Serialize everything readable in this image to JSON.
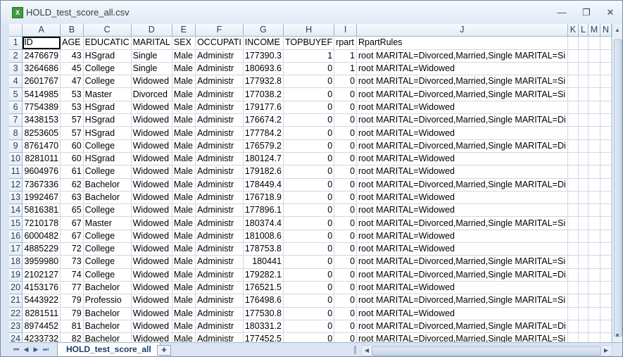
{
  "window": {
    "title": "HOLD_test_score_all.csv",
    "app_icon_letter": "X",
    "minimize_glyph": "—",
    "restore_glyph": "❐",
    "close_glyph": "✕"
  },
  "grid": {
    "column_letters": [
      "A",
      "B",
      "C",
      "D",
      "E",
      "F",
      "G",
      "H",
      "I",
      "J",
      "K",
      "L",
      "M",
      "N"
    ],
    "active_column": "A",
    "active_row": 1,
    "header_row": [
      "ID",
      "AGE",
      "EDUCATIC",
      "MARITAL",
      "SEX",
      "OCCUPATI",
      "INCOME",
      "TOPBUYEF",
      "rpart",
      "RpartRules",
      "",
      "",
      "",
      ""
    ],
    "rows": [
      [
        "2476679",
        "43",
        "HSgrad",
        "Single",
        "Male",
        "Administr",
        "177390.3",
        "1",
        "1",
        "root MARITAL=Divorced,Married,Single MARITAL=Si"
      ],
      [
        "3264686",
        "45",
        "College",
        "Single",
        "Male",
        "Administr",
        "180693.6",
        "0",
        "1",
        "root MARITAL=Widowed"
      ],
      [
        "2601767",
        "47",
        "College",
        "Widowed",
        "Male",
        "Administr",
        "177932.8",
        "0",
        "0",
        "root MARITAL=Divorced,Married,Single MARITAL=Si"
      ],
      [
        "5414985",
        "53",
        "Master",
        "Divorced",
        "Male",
        "Administr",
        "177038.2",
        "0",
        "0",
        "root MARITAL=Divorced,Married,Single MARITAL=Si"
      ],
      [
        "7754389",
        "53",
        "HSgrad",
        "Widowed",
        "Male",
        "Administr",
        "179177.6",
        "0",
        "0",
        "root MARITAL=Widowed"
      ],
      [
        "3438153",
        "57",
        "HSgrad",
        "Widowed",
        "Male",
        "Administr",
        "176674.2",
        "0",
        "0",
        "root MARITAL=Divorced,Married,Single MARITAL=Di"
      ],
      [
        "8253605",
        "57",
        "HSgrad",
        "Widowed",
        "Male",
        "Administr",
        "177784.2",
        "0",
        "0",
        "root MARITAL=Widowed"
      ],
      [
        "8761470",
        "60",
        "College",
        "Widowed",
        "Male",
        "Administr",
        "176579.2",
        "0",
        "0",
        "root MARITAL=Divorced,Married,Single MARITAL=Di"
      ],
      [
        "8281011",
        "60",
        "HSgrad",
        "Widowed",
        "Male",
        "Administr",
        "180124.7",
        "0",
        "0",
        "root MARITAL=Widowed"
      ],
      [
        "9604976",
        "61",
        "College",
        "Widowed",
        "Male",
        "Administr",
        "179182.6",
        "0",
        "0",
        "root MARITAL=Widowed"
      ],
      [
        "7367336",
        "62",
        "Bachelor",
        "Widowed",
        "Male",
        "Administr",
        "178449.4",
        "0",
        "0",
        "root MARITAL=Divorced,Married,Single MARITAL=Di"
      ],
      [
        "1992467",
        "63",
        "Bachelor",
        "Widowed",
        "Male",
        "Administr",
        "176718.9",
        "0",
        "0",
        "root MARITAL=Widowed"
      ],
      [
        "5816381",
        "65",
        "College",
        "Widowed",
        "Male",
        "Administr",
        "177896.1",
        "0",
        "0",
        "root MARITAL=Widowed"
      ],
      [
        "7210178",
        "67",
        "Master",
        "Widowed",
        "Male",
        "Administr",
        "180374.4",
        "0",
        "0",
        "root MARITAL=Divorced,Married,Single MARITAL=Si"
      ],
      [
        "6000482",
        "67",
        "College",
        "Widowed",
        "Male",
        "Administr",
        "181008.6",
        "0",
        "0",
        "root MARITAL=Widowed"
      ],
      [
        "4885229",
        "72",
        "College",
        "Widowed",
        "Male",
        "Administr",
        "178753.8",
        "0",
        "0",
        "root MARITAL=Widowed"
      ],
      [
        "3959980",
        "73",
        "College",
        "Widowed",
        "Male",
        "Administr",
        "180441",
        "0",
        "0",
        "root MARITAL=Divorced,Married,Single MARITAL=Si"
      ],
      [
        "2102127",
        "74",
        "College",
        "Widowed",
        "Male",
        "Administr",
        "179282.1",
        "0",
        "0",
        "root MARITAL=Divorced,Married,Single MARITAL=Di"
      ],
      [
        "4153176",
        "77",
        "Bachelor",
        "Widowed",
        "Male",
        "Administr",
        "176521.5",
        "0",
        "0",
        "root MARITAL=Widowed"
      ],
      [
        "5443922",
        "79",
        "Professio",
        "Widowed",
        "Male",
        "Administr",
        "176498.6",
        "0",
        "0",
        "root MARITAL=Divorced,Married,Single MARITAL=Si"
      ],
      [
        "8281511",
        "79",
        "Bachelor",
        "Widowed",
        "Male",
        "Administr",
        "177530.8",
        "0",
        "0",
        "root MARITAL=Widowed"
      ],
      [
        "8974452",
        "81",
        "Bachelor",
        "Widowed",
        "Male",
        "Administr",
        "180331.2",
        "0",
        "0",
        "root MARITAL=Divorced,Married,Single MARITAL=Di"
      ],
      [
        "4233732",
        "82",
        "Bachelor",
        "Widowed",
        "Male",
        "Administr",
        "177452.5",
        "0",
        "0",
        "root MARITAL=Divorced,Married,Single MARITAL=Si"
      ]
    ]
  },
  "footer": {
    "nav_first": "⏮",
    "nav_prev": "◀",
    "nav_next": "▶",
    "nav_last": "⏭",
    "sheet_tab": "HOLD_test_score_all",
    "new_sheet_glyph": "✚"
  },
  "scroll": {
    "up_glyph": "▲",
    "down_glyph": "▼",
    "left_glyph": "◀",
    "right_glyph": "▶"
  }
}
